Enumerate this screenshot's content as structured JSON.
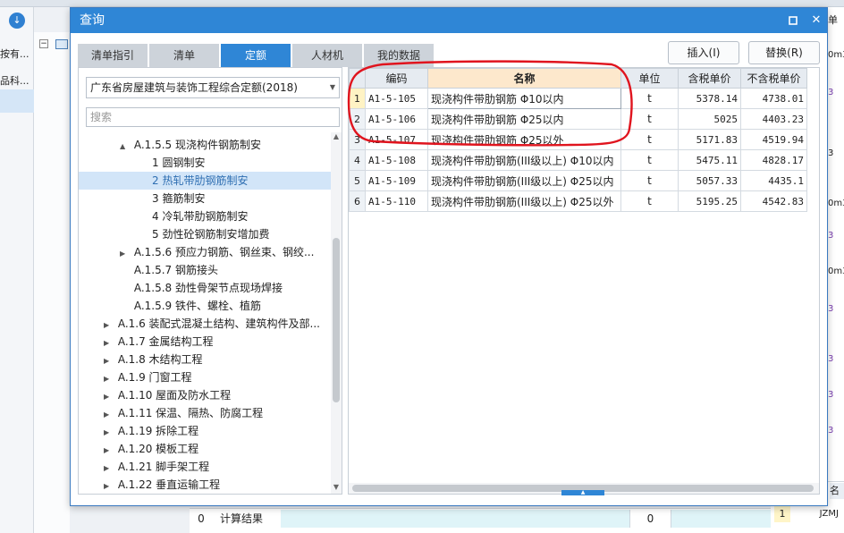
{
  "background": {
    "left_items": [
      "按有...",
      "品科..."
    ],
    "right_items": [
      "0m3",
      "3",
      "3",
      "0m3",
      "3",
      "0m3",
      "3",
      "3",
      "3",
      "3"
    ],
    "right_top_header": "单",
    "bottom_row": {
      "index": "0",
      "label": "计算结果",
      "value": "0"
    },
    "bottom_right": {
      "header": "名",
      "row_num": "1",
      "code": "JZMJ"
    }
  },
  "dialog": {
    "title": "查询",
    "maximize_icon": "square",
    "close_icon": "✕",
    "tabs": [
      {
        "label": "清单指引",
        "active": false
      },
      {
        "label": "清单",
        "active": false
      },
      {
        "label": "定额",
        "active": true
      },
      {
        "label": "人材机",
        "active": false
      },
      {
        "label": "我的数据",
        "active": false
      }
    ],
    "buttons": {
      "insert": "插入(I)",
      "replace": "替换(R)"
    },
    "quota_select": "广东省房屋建筑与装饰工程综合定额(2018)",
    "search_placeholder": "搜索",
    "tree": [
      {
        "label": "A.1.5.5 现浇构件钢筋制安",
        "toggle": "▲",
        "level": 2,
        "selected": false
      },
      {
        "label": "1 圆钢制安",
        "toggle": "",
        "level": 3,
        "selected": false
      },
      {
        "label": "2 热轧带肋钢筋制安",
        "toggle": "",
        "level": 3,
        "selected": true
      },
      {
        "label": "3 箍筋制安",
        "toggle": "",
        "level": 3,
        "selected": false
      },
      {
        "label": "4 冷轧带肋钢筋制安",
        "toggle": "",
        "level": 3,
        "selected": false
      },
      {
        "label": "5 劲性砼钢筋制安增加费",
        "toggle": "",
        "level": 3,
        "selected": false
      },
      {
        "label": "A.1.5.6 预应力钢筋、钢丝束、钢绞...",
        "toggle": "▶",
        "level": 2,
        "selected": false
      },
      {
        "label": "A.1.5.7 钢筋接头",
        "toggle": "",
        "level": 2,
        "selected": false
      },
      {
        "label": "A.1.5.8 劲性骨架节点现场焊接",
        "toggle": "",
        "level": 2,
        "selected": false
      },
      {
        "label": "A.1.5.9 铁件、螺栓、植筋",
        "toggle": "",
        "level": 2,
        "selected": false
      },
      {
        "label": "A.1.6 装配式混凝土结构、建筑构件及部...",
        "toggle": "▶",
        "level": 1,
        "selected": false
      },
      {
        "label": "A.1.7 金属结构工程",
        "toggle": "▶",
        "level": 1,
        "selected": false
      },
      {
        "label": "A.1.8 木结构工程",
        "toggle": "▶",
        "level": 1,
        "selected": false
      },
      {
        "label": "A.1.9 门窗工程",
        "toggle": "▶",
        "level": 1,
        "selected": false
      },
      {
        "label": "A.1.10 屋面及防水工程",
        "toggle": "▶",
        "level": 1,
        "selected": false
      },
      {
        "label": "A.1.11 保温、隔热、防腐工程",
        "toggle": "▶",
        "level": 1,
        "selected": false
      },
      {
        "label": "A.1.19 拆除工程",
        "toggle": "▶",
        "level": 1,
        "selected": false
      },
      {
        "label": "A.1.20 模板工程",
        "toggle": "▶",
        "level": 1,
        "selected": false
      },
      {
        "label": "A.1.21 脚手架工程",
        "toggle": "▶",
        "level": 1,
        "selected": false
      },
      {
        "label": "A.1.22 垂直运输工程",
        "toggle": "▶",
        "level": 1,
        "selected": false
      }
    ],
    "grid": {
      "columns": [
        "",
        "编码",
        "名称",
        "单位",
        "含税单价",
        "不含税单价"
      ],
      "rows": [
        {
          "no": "1",
          "code": "A1-5-105",
          "name": "现浇构件带肋钢筋 Φ10以内",
          "unit": "t",
          "price_tax": "5378.14",
          "price_notax": "4738.01"
        },
        {
          "no": "2",
          "code": "A1-5-106",
          "name": "现浇构件带肋钢筋 Φ25以内",
          "unit": "t",
          "price_tax": "5025",
          "price_notax": "4403.23"
        },
        {
          "no": "3",
          "code": "A1-5-107",
          "name": "现浇构件带肋钢筋 Φ25以外",
          "unit": "t",
          "price_tax": "5171.83",
          "price_notax": "4519.94"
        },
        {
          "no": "4",
          "code": "A1-5-108",
          "name": "现浇构件带肋钢筋(III级以上) Φ10以内",
          "unit": "t",
          "price_tax": "5475.11",
          "price_notax": "4828.17"
        },
        {
          "no": "5",
          "code": "A1-5-109",
          "name": "现浇构件带肋钢筋(III级以上) Φ25以内",
          "unit": "t",
          "price_tax": "5057.33",
          "price_notax": "4435.1"
        },
        {
          "no": "6",
          "code": "A1-5-110",
          "name": "现浇构件带肋钢筋(III级以上) Φ25以外",
          "unit": "t",
          "price_tax": "5195.25",
          "price_notax": "4542.83"
        }
      ]
    },
    "annotation_color": "#e0141e"
  }
}
